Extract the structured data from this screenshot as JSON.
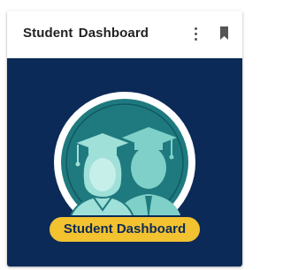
{
  "card": {
    "title": "Student Dashboard",
    "badge_label": "Student Dashboard"
  },
  "icons": {
    "menu": "more-vertical-icon",
    "bookmark": "bookmark-icon",
    "illustration": "graduates-icon"
  },
  "colors": {
    "body_background": "#0c2a57",
    "ring": "#ffffff",
    "circle": "#1f7a7f",
    "figure": "#7fd0c8",
    "badge": "#f2c230"
  }
}
